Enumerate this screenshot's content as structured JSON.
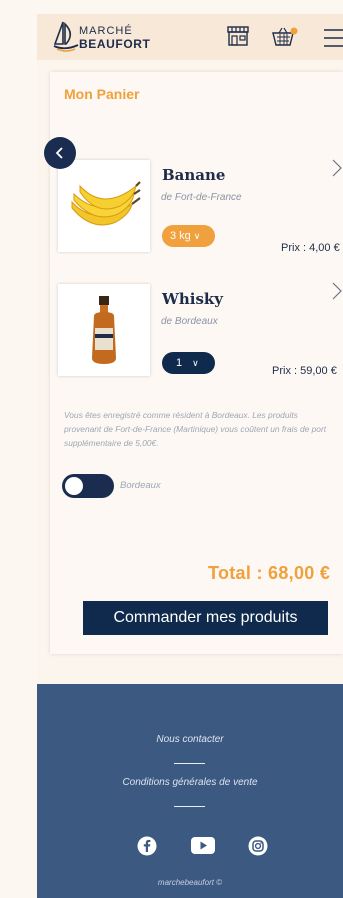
{
  "header": {
    "logo_top": "MARCHÉ",
    "logo_bottom": "BEAUFORT",
    "icons": [
      "store-icon",
      "basket-icon",
      "menu-icon"
    ],
    "cart_badge_color": "#f0a03c"
  },
  "cart": {
    "title": "Mon Panier",
    "items": [
      {
        "name": "Banane",
        "origin": "de Fort-de-France",
        "quantity": "3 kg",
        "quantity_style": "orange",
        "price": "Prix : 4,00 €"
      },
      {
        "name": "Whisky",
        "origin": "de Bordeaux",
        "quantity": "1",
        "quantity_style": "navy",
        "price": "Prix : 59,00 €"
      }
    ],
    "notice": "Vous êtes enregistré comme résident à Bordeaux. Les produits provenant de Fort-de-France (Martinique) vous coûtent un frais de port supplémentaire de 5,00€.",
    "toggle_label": "Bordeaux",
    "total": "Total : 68,00 €",
    "order_button": "Commander mes produits"
  },
  "footer": {
    "contact": "Nous contacter",
    "terms": "Conditions générales de vente",
    "social": [
      "facebook-icon",
      "youtube-icon",
      "instagram-icon"
    ],
    "copyright": "marchebeaufort ©"
  },
  "colors": {
    "accent": "#f0a03c",
    "navy": "#0f2a4d",
    "footer": "#3c5982",
    "header": "#f7e8d8"
  }
}
